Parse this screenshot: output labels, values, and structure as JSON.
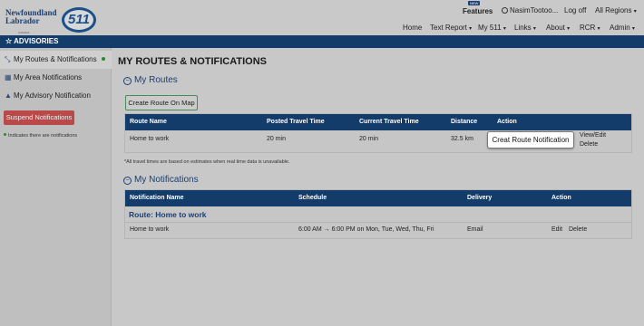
{
  "header": {
    "logo_text": "Newfoundland\nLabrador",
    "logo_sub": "CANADA",
    "logo_511": "511",
    "new_badge": "NEW",
    "features": "Features",
    "user": "NasimTootoo...",
    "logoff": "Log off",
    "regions": "All Regions"
  },
  "nav": [
    "Home",
    "Text Report",
    "My 511",
    "Links",
    "About",
    "RCR",
    "Admin"
  ],
  "advisories": "ADVISORIES",
  "sidebar": {
    "items": [
      {
        "label": "My Routes & Notifications",
        "icon": "route-icon"
      },
      {
        "label": "My Area Notifications",
        "icon": "map-icon"
      },
      {
        "label": "My Advisory Notification",
        "icon": "warning-icon"
      }
    ],
    "suspend_label": "Suspend Notifications",
    "legend": "Indicates there are notifications"
  },
  "main": {
    "title": "MY ROUTES & NOTIFICATIONS",
    "routes_title": "My Routes",
    "create_button": "Create Route On Map",
    "routes_headers": [
      "Route Name",
      "Posted Travel Time",
      "Current Travel Time",
      "Distance",
      "Action"
    ],
    "routes_rows": [
      {
        "name": "Home to work",
        "posted": "20 min",
        "current": "20 min",
        "distance": "32.5 km",
        "action_edit": "View/Edit",
        "action_delete": "Delete"
      }
    ],
    "note": "*All travel times are based on estimates when real time data is unavailable.",
    "tooltip": "Creat Route Notification",
    "notifications_title": "My Notifications",
    "notif_headers": [
      "Notification Name",
      "Schedule",
      "Delivery",
      "Action"
    ],
    "notif_group": "Route: Home to work",
    "notif_rows": [
      {
        "name": "Home to work",
        "schedule": "6:00 AM → 6:00 PM on Mon, Tue, Wed, Thu, Fri",
        "delivery": "Email",
        "edit": "Edit",
        "delete": "Delete"
      }
    ]
  },
  "colors": {
    "navy": "#143c6b",
    "suspend": "#b94a4a",
    "notification_dot": "#2a8a2a"
  }
}
